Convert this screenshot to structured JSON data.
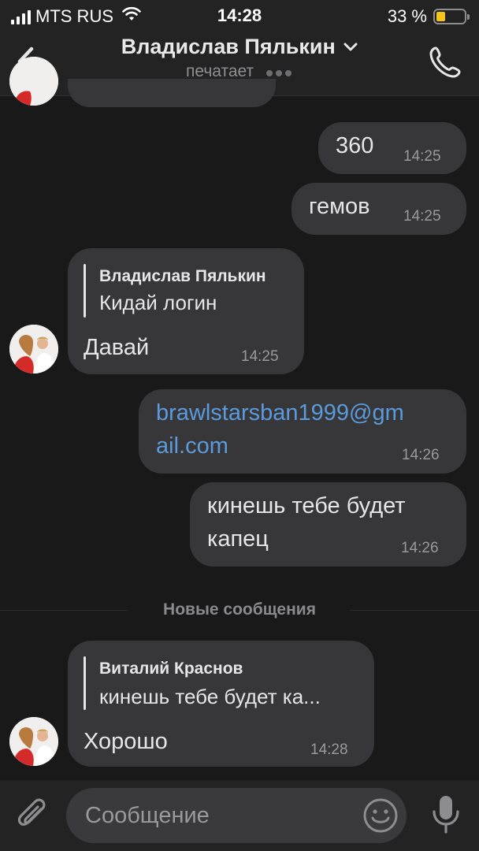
{
  "status_bar": {
    "carrier": "MTS RUS",
    "time": "14:28",
    "battery_percent_label": "33 %",
    "battery_level": 0.33
  },
  "header": {
    "title": "Владислав Пялькин",
    "subtitle": "печатает"
  },
  "messages": [
    {
      "direction": "outgoing",
      "text": "360",
      "time": "14:25"
    },
    {
      "direction": "outgoing",
      "text": "гемов",
      "time": "14:25"
    },
    {
      "direction": "incoming",
      "reply_author": "Владислав Пялькин",
      "reply_text": "Кидай логин",
      "text": "Давай",
      "time": "14:25"
    },
    {
      "direction": "outgoing",
      "text_line1": "brawlstarsban1999@gm",
      "text_line2": "ail.com",
      "time": "14:26"
    },
    {
      "direction": "outgoing",
      "text_line1": "кинешь тебе будет",
      "text_line2": "капец",
      "time": "14:26"
    },
    {
      "direction": "incoming",
      "reply_author": "Виталий Краснов",
      "reply_text": "кинешь тебе будет ка...",
      "text": "Хорошо",
      "time": "14:28"
    }
  ],
  "new_messages_label": "Новые сообщения",
  "composer": {
    "placeholder": "Сообщение"
  },
  "icons": [
    "signal-icon",
    "wifi-icon",
    "battery-icon",
    "back-icon",
    "chevron-down-icon",
    "phone-icon",
    "paperclip-icon",
    "emoji-icon",
    "microphone-icon"
  ],
  "colors": {
    "background": "#19191a",
    "bar": "#232324",
    "bubble": "#37373a",
    "link": "#5b9bdc",
    "battery": "#f5c518"
  }
}
